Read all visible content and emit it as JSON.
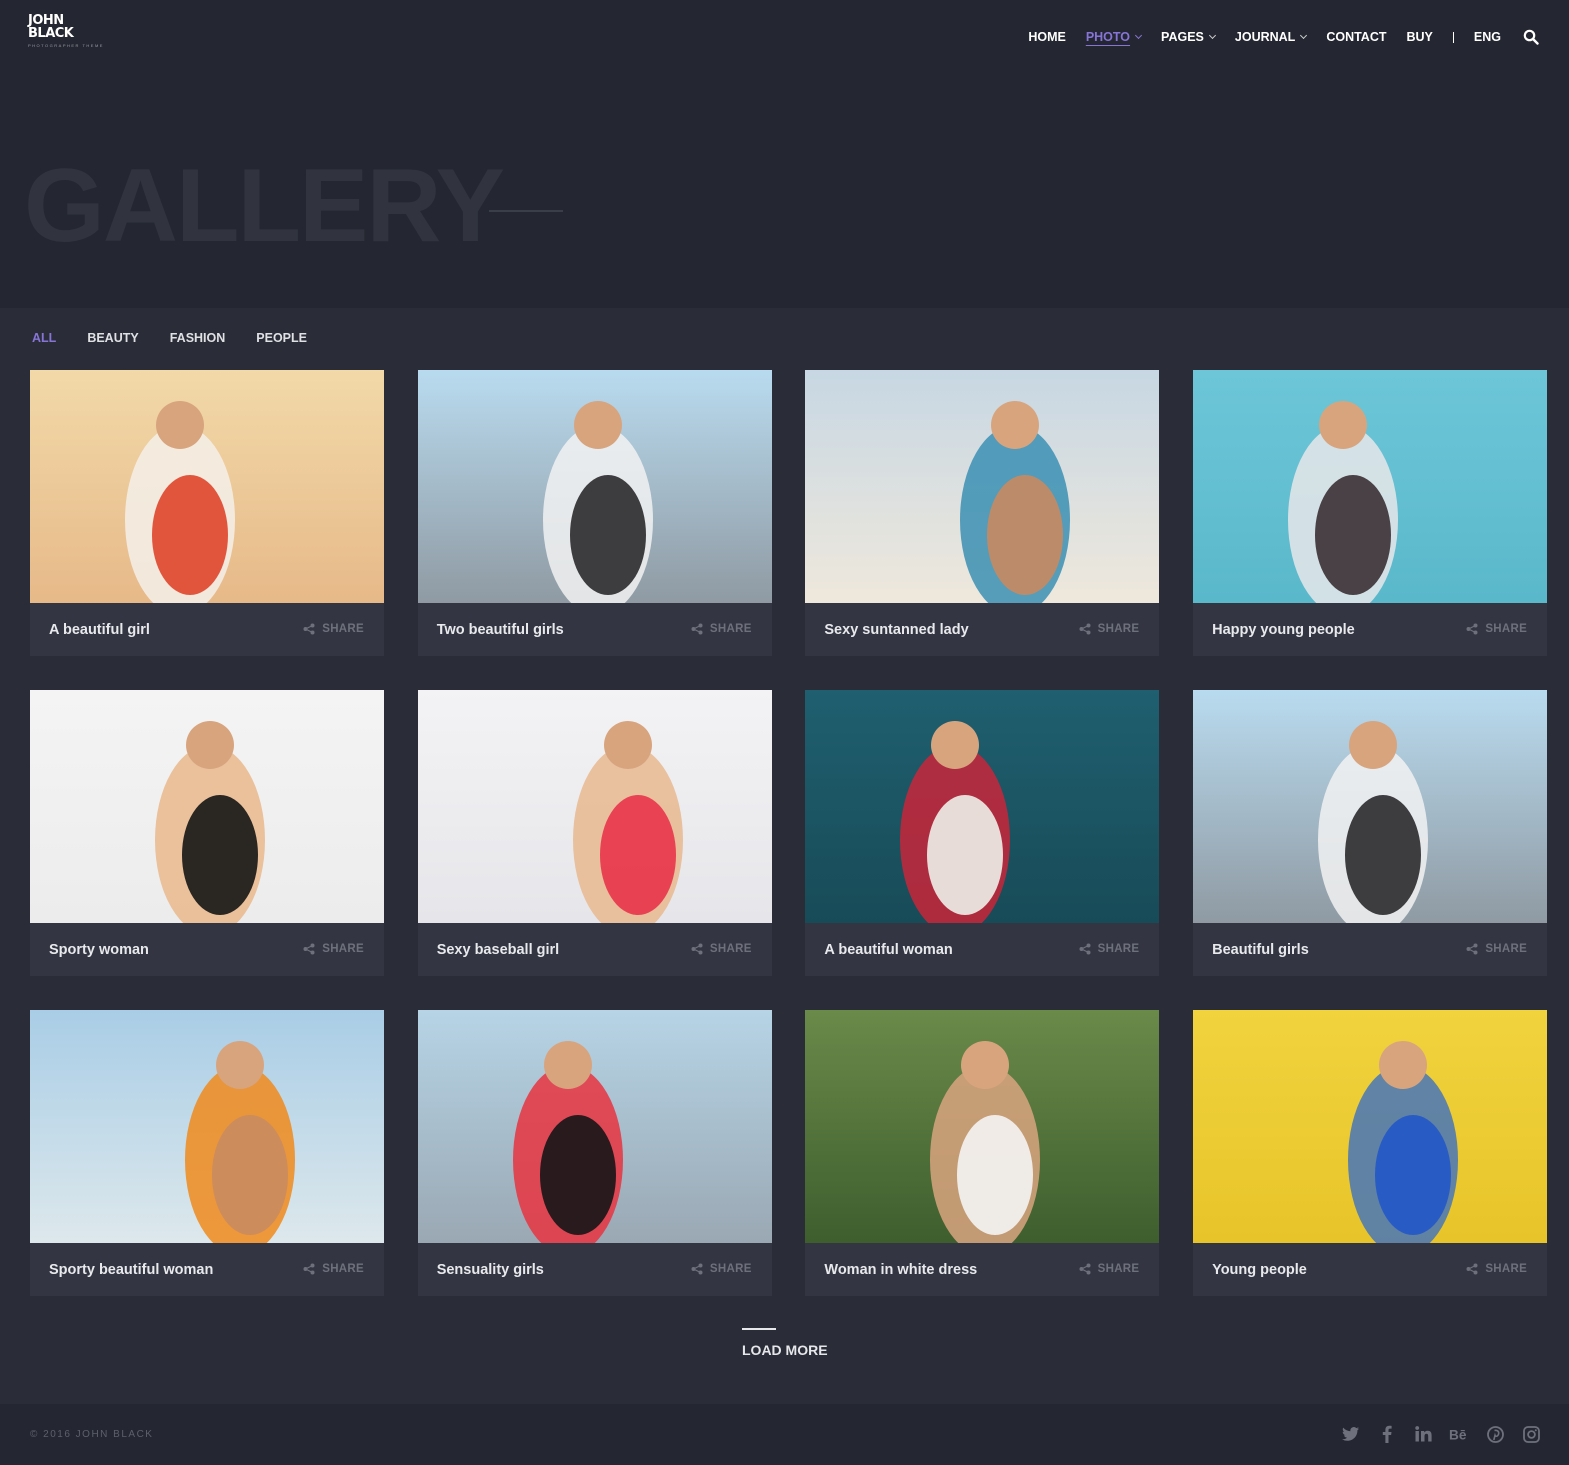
{
  "logo": {
    "line1": "JOHN",
    "line2": "BLACK",
    "tagline": "PHOTOGRAPHER THEME"
  },
  "nav": {
    "items": [
      {
        "label": "HOME",
        "dropdown": false,
        "active": false
      },
      {
        "label": "PHOTO",
        "dropdown": true,
        "active": true
      },
      {
        "label": "PAGES",
        "dropdown": true,
        "active": false
      },
      {
        "label": "JOURNAL",
        "dropdown": true,
        "active": false
      },
      {
        "label": "CONTACT",
        "dropdown": false,
        "active": false
      },
      {
        "label": "BUY",
        "dropdown": false,
        "active": false
      }
    ],
    "lang": "ENG",
    "search_icon": "search-icon"
  },
  "hero": {
    "title": "GALLERY"
  },
  "filters": [
    "ALL",
    "BEAUTY",
    "FASHION",
    "PEOPLE"
  ],
  "active_filter": "ALL",
  "gallery": [
    {
      "caption": "A beautiful girl",
      "share": "SHARE"
    },
    {
      "caption": "Two beautiful girls",
      "share": "SHARE"
    },
    {
      "caption": "Sexy suntanned lady",
      "share": "SHARE"
    },
    {
      "caption": "Happy young people",
      "share": "SHARE"
    },
    {
      "caption": "Sporty woman",
      "share": "SHARE"
    },
    {
      "caption": "Sexy baseball girl",
      "share": "SHARE"
    },
    {
      "caption": "A beautiful woman",
      "share": "SHARE"
    },
    {
      "caption": "Beautiful girls",
      "share": "SHARE"
    },
    {
      "caption": "Sporty beautiful woman",
      "share": "SHARE"
    },
    {
      "caption": "Sensuality girls",
      "share": "SHARE"
    },
    {
      "caption": "Woman in white dress",
      "share": "SHARE"
    },
    {
      "caption": "Young people",
      "share": "SHARE"
    }
  ],
  "load_more": "LOAD MORE",
  "footer": {
    "copyright": "© 2016 JOHN BLACK",
    "socials": [
      "twitter-icon",
      "facebook-icon",
      "linkedin-icon",
      "behance-icon",
      "pinterest-icon",
      "instagram-icon"
    ]
  },
  "colors": {
    "accent": "#8675d6",
    "background": "#2a2d37",
    "header": "#242731",
    "card": "#333642"
  }
}
